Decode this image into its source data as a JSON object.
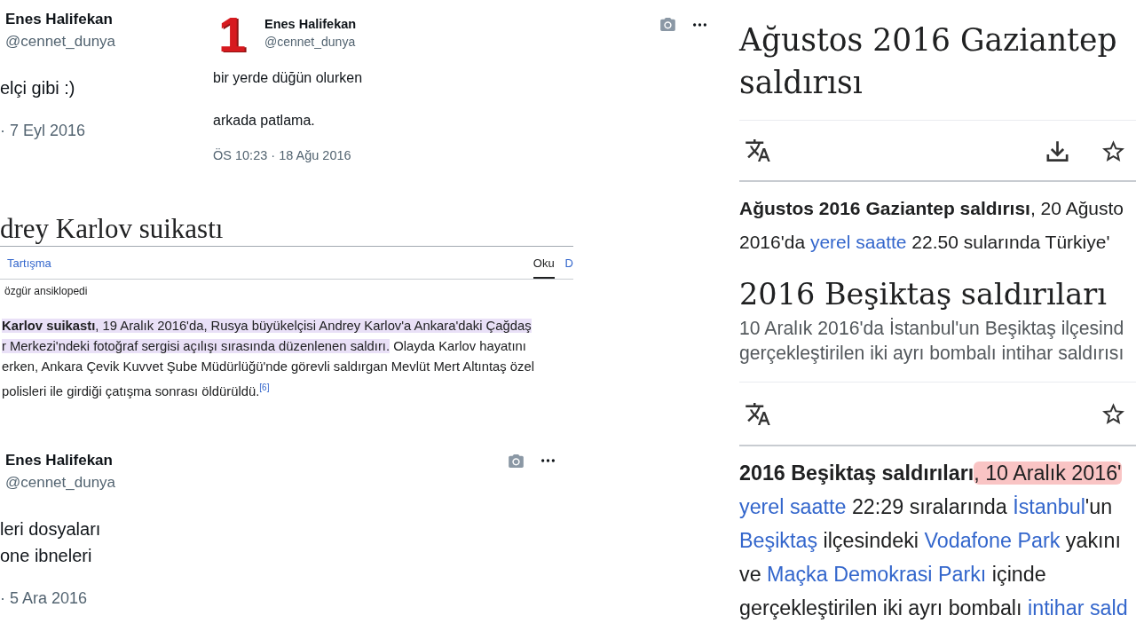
{
  "top_tweets": [
    {
      "kind": "large",
      "name": "Enes Halifekan",
      "handle": "@cennet_dunya",
      "lines": [
        "elçi gibi :)"
      ],
      "timestamp": "· 7 Eyl 2016",
      "menu_icons": false
    },
    {
      "kind": "compact",
      "avatar_text": "1",
      "name": "Enes Halifekan",
      "handle": "@cennet_dunya",
      "lines": [
        "bir yerde düğün olurken",
        "arkada patlama."
      ],
      "timestamp": "ÖS 10:23 · 18 Ağu 2016",
      "menu_icons": true
    }
  ],
  "karlov_article": {
    "title": "drey Karlov suikastı",
    "tabs_start": [
      {
        "label": "Tartışma",
        "selected": false
      }
    ],
    "tabs_end": [
      {
        "label": "Oku",
        "selected": true
      },
      {
        "label": "D",
        "selected": false
      }
    ],
    "tagline": "özgür ansiklopedi",
    "lines": [
      [
        {
          "text": "**Karlov suikastı**, 19 Aralık 2016'da, Rusya büyükelçisi Andrey Karlov'a Ankara'daki Çağdaş",
          "link": false,
          "highlighted": true
        }
      ],
      [
        {
          "text": "r Merkezi'ndeki fotoğraf sergisi açılışı sırasında düzenlenen saldırı.",
          "link": false,
          "highlighted": true
        },
        {
          "text": " Olayda Karlov hayatını",
          "link": false,
          "highlighted": false
        }
      ],
      [
        {
          "text": "erken, Ankara Çevik Kuvvet Şube Müdürlüğü'nde görevli saldırgan Mevlüt Mert Altıntaş özel",
          "link": false,
          "highlighted": false
        }
      ],
      [
        {
          "text": "polisleri ile girdiği çatışma sonrası öldürüldü.",
          "link": false,
          "highlighted": false
        },
        {
          "text": "$^{[6]}$",
          "link": true,
          "highlighted": false
        }
      ]
    ]
  },
  "bottom_tweet": {
    "kind": "large",
    "name": "Enes Halifekan",
    "handle": "@cennet_dunya",
    "lines": [
      "leri dosyaları",
      "one ibneleri"
    ],
    "timestamp": "· 5 Ara 2016",
    "menu_icons": true
  },
  "wiki_articles": [
    {
      "title": "Ağustos 2016 Gaziantep saldırısı",
      "toolbar_start": [
        {
          "kind": "translate"
        }
      ],
      "toolbar_end": [
        {
          "kind": "download"
        },
        {
          "kind": "star"
        }
      ],
      "lines": [
        [
          {
            "text": "**Ağustos 2016 Gaziantep saldırısı**, 20 Ağusto",
            "link": false,
            "highlighted": false
          }
        ],
        [
          {
            "text": "2016'da ",
            "link": false,
            "highlighted": false
          },
          {
            "text": "yerel saatte",
            "link": true,
            "highlighted": false
          },
          {
            "text": " 22.50 sularında Türkiye'",
            "link": false,
            "highlighted": false
          }
        ]
      ]
    },
    {
      "title": "2016 Beşiktaş saldırıları",
      "description": [
        "10 Aralık 2016'da İstanbul'un Beşiktaş ilçesind",
        "gerçekleştirilen iki ayrı bombalı intihar saldırısı"
      ],
      "toolbar_start": [
        {
          "kind": "translate"
        }
      ],
      "toolbar_end": [
        {
          "kind": "star"
        }
      ],
      "lines": [
        [
          {
            "text": "**2016 Beşiktaş saldırıları**",
            "link": false,
            "highlighted": false
          },
          {
            "text": ", 10 Aralık 2016'",
            "link": false,
            "highlighted": true
          }
        ],
        [
          {
            "text": "yerel saatte",
            "link": true,
            "highlighted": false
          },
          {
            "text": " 22:29 sıralarında ",
            "link": false,
            "highlighted": false
          },
          {
            "text": "İstanbul",
            "link": true,
            "highlighted": false
          },
          {
            "text": "'un",
            "link": false,
            "highlighted": false
          }
        ],
        [
          {
            "text": "Beşiktaş",
            "link": true,
            "highlighted": false
          },
          {
            "text": " ilçesindeki ",
            "link": false,
            "highlighted": false
          },
          {
            "text": "Vodafone Park",
            "link": true,
            "highlighted": false
          },
          {
            "text": " yakını",
            "link": false,
            "highlighted": false
          }
        ],
        [
          {
            "text": "ve ",
            "link": false,
            "highlighted": false
          },
          {
            "text": "Maçka Demokrasi Parkı",
            "link": true,
            "highlighted": false
          },
          {
            "text": " içinde",
            "link": false,
            "highlighted": false
          }
        ],
        [
          {
            "text": "gerçekleştirilen iki ayrı bombalı ",
            "link": false,
            "highlighted": false
          },
          {
            "text": "intihar sald",
            "link": true,
            "highlighted": false
          }
        ]
      ]
    }
  ]
}
